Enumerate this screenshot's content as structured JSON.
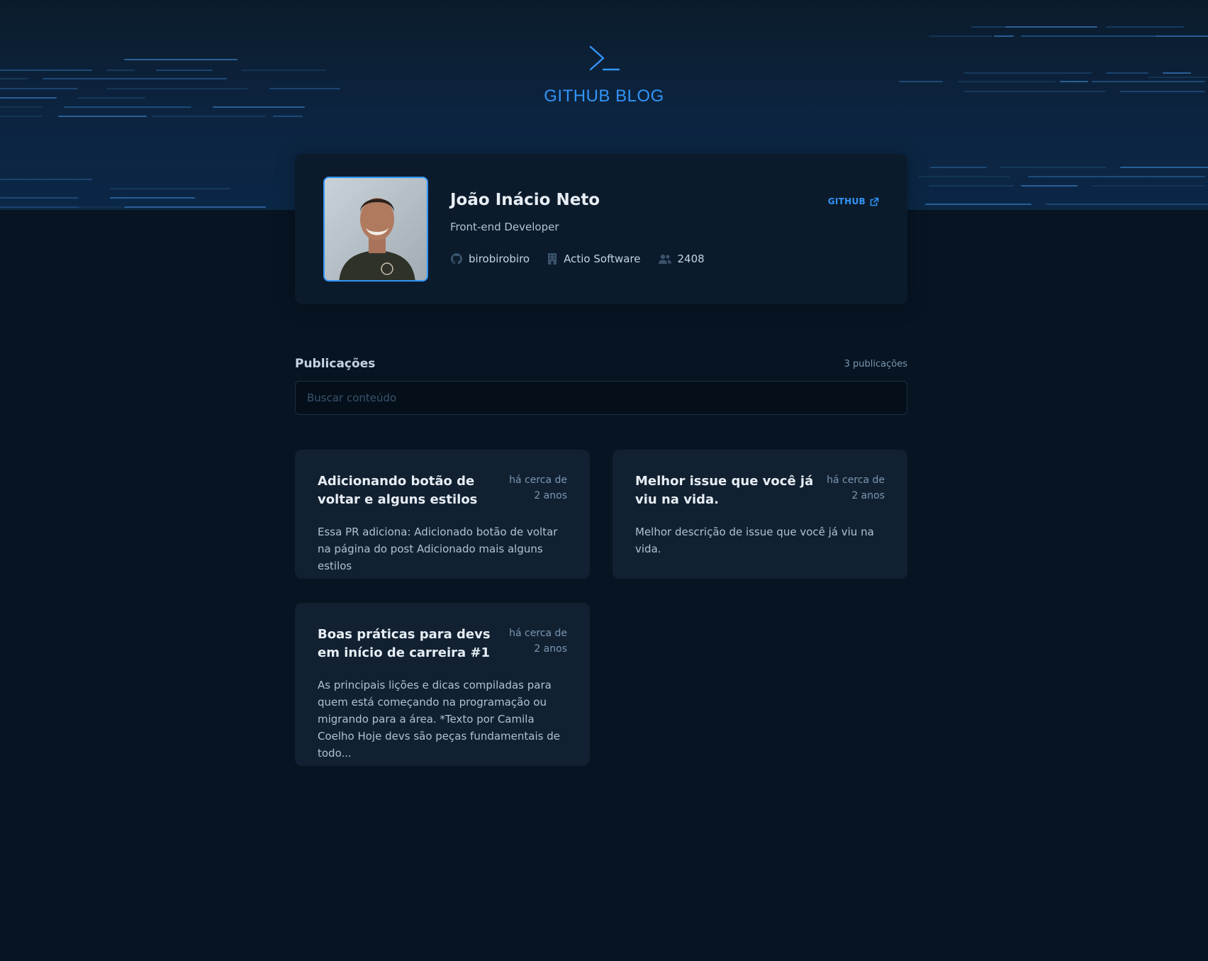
{
  "header": {
    "title": "GITHUB BLOG",
    "logo_icon": "terminal-prompt-icon"
  },
  "profile": {
    "name": "João Inácio Neto",
    "role": "Front-end Developer",
    "github_link_label": "GITHUB",
    "username": "birobirobiro",
    "company": "Actio Software",
    "followers": "2408",
    "icons": {
      "github": "github-icon",
      "company": "building-icon",
      "followers": "users-icon",
      "external": "external-link-icon"
    }
  },
  "publications": {
    "title": "Publicações",
    "count_label": "3 publicações",
    "search_placeholder": "Buscar conteúdo",
    "posts": [
      {
        "title": "Adicionando botão de voltar e alguns estilos",
        "date": "há cerca de 2 anos",
        "excerpt": "Essa PR adiciona: Adicionado botão de voltar na página do post Adicionado mais alguns estilos"
      },
      {
        "title": "Melhor issue que você já viu na vida.",
        "date": "há cerca de 2 anos",
        "excerpt": "Melhor descrição de issue que você já viu na vida."
      },
      {
        "title": "Boas práticas para devs em início de carreira #1",
        "date": "há cerca de 2 anos",
        "excerpt": "As principais lições e dicas compiladas para quem está começando na programação ou migrando para a área. *Texto por Camila Coelho Hoje devs são peças fundamentais de todo..."
      }
    ]
  },
  "colors": {
    "accent": "#3294F8",
    "background": "#071422",
    "card": "#112131",
    "profile_card": "#0B1B2B"
  }
}
